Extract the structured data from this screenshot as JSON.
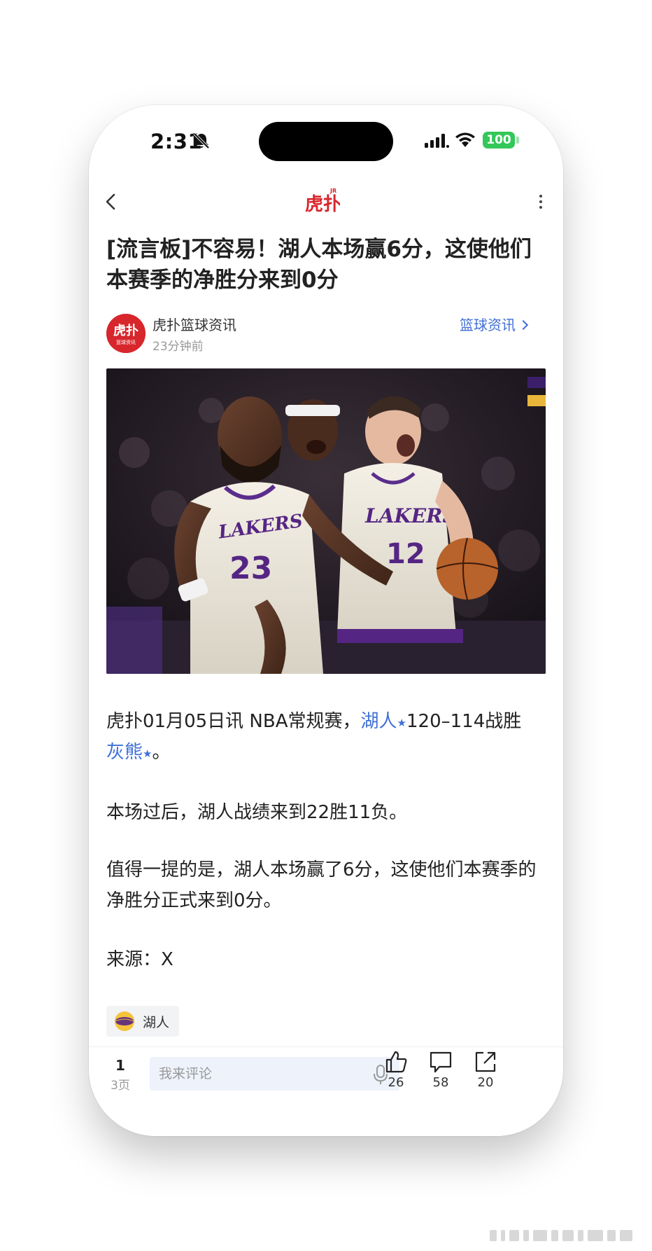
{
  "status_bar": {
    "time": "2:31",
    "battery": "100"
  },
  "nav": {
    "logo_text": "虎扑",
    "logo_badge": "JR"
  },
  "article": {
    "title": "[流言板]不容易！湖人本场赢6分，这使他们本赛季的净胜分来到0分",
    "author": {
      "name": "虎扑篮球资讯",
      "avatar_text_top": "虎扑",
      "avatar_text_bottom": "篮球资讯",
      "time": "23分钟前"
    },
    "category": "篮球资讯",
    "p1_prefix": "虎扑01月05日讯 NBA常规赛，",
    "p1_team1": "湖人",
    "p1_middle": "120–114战胜",
    "p1_team2": "灰熊",
    "p1_suffix": "。",
    "p2": "本场过后，湖人战绩来到22胜11负。",
    "p3": "值得一提的是，湖人本场赢了6分，这使他们本赛季的净胜分正式来到0分。",
    "p4": "来源：X",
    "tag": "湖人"
  },
  "bottom_bar": {
    "page_current": "1",
    "page_total": "3页",
    "comment_placeholder": "我来评论",
    "like_count": "26",
    "comment_count": "58",
    "share_count": "20"
  },
  "colors": {
    "accent_blue": "#3f6fd6",
    "brand_red": "#d7262c",
    "battery_green": "#34c759"
  }
}
